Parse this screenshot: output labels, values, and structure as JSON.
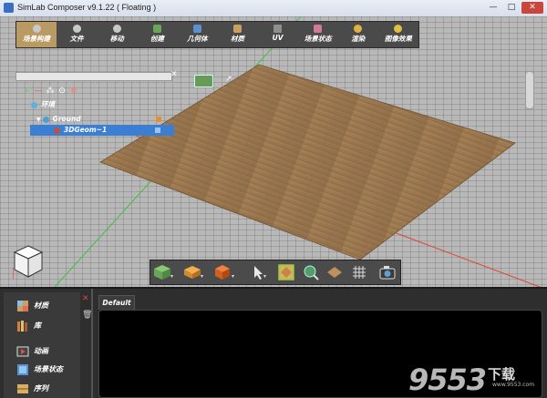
{
  "window": {
    "title": "SimLab Composer v9.1.22 ( Floating )",
    "minimize": "—",
    "maximize": "□",
    "close": "✕"
  },
  "menu": {
    "tabs": [
      {
        "label": "场景构建",
        "icon": "scene-build-icon",
        "active": true
      },
      {
        "label": "文件",
        "icon": "file-icon"
      },
      {
        "label": "移动",
        "icon": "move-icon"
      },
      {
        "label": "创建",
        "icon": "create-icon"
      },
      {
        "label": "几何体",
        "icon": "geometry-icon"
      },
      {
        "label": "材质",
        "icon": "material-icon"
      },
      {
        "label": "UV",
        "icon": "uv-icon"
      },
      {
        "label": "场景状态",
        "icon": "scene-state-icon"
      },
      {
        "label": "渲染",
        "icon": "render-icon"
      },
      {
        "label": "图像效果",
        "icon": "image-effect-icon"
      }
    ]
  },
  "scene_tree": {
    "nodes": [
      {
        "label": "环境"
      },
      {
        "label": "Ground"
      },
      {
        "label": "3DGeom~1",
        "selected": true
      }
    ]
  },
  "bottom_panel": {
    "library_items": [
      {
        "label": "材质",
        "icon": "materials-icon"
      },
      {
        "label": "库",
        "icon": "library-icon"
      },
      {
        "label": "动画",
        "icon": "animation-icon"
      },
      {
        "label": "场景状态",
        "icon": "scene-states-icon"
      },
      {
        "label": "序列",
        "icon": "sequence-icon"
      }
    ],
    "tab_label": "Default"
  },
  "watermark": {
    "text": "9553",
    "sub": "下载",
    "url": "www.9553.com"
  },
  "colors": {
    "menu_active": "#b99a63",
    "floor_wood": "#9b7b55",
    "selection": "#3b7fd4",
    "axis_red": "#e04030",
    "axis_green": "#40c040"
  }
}
